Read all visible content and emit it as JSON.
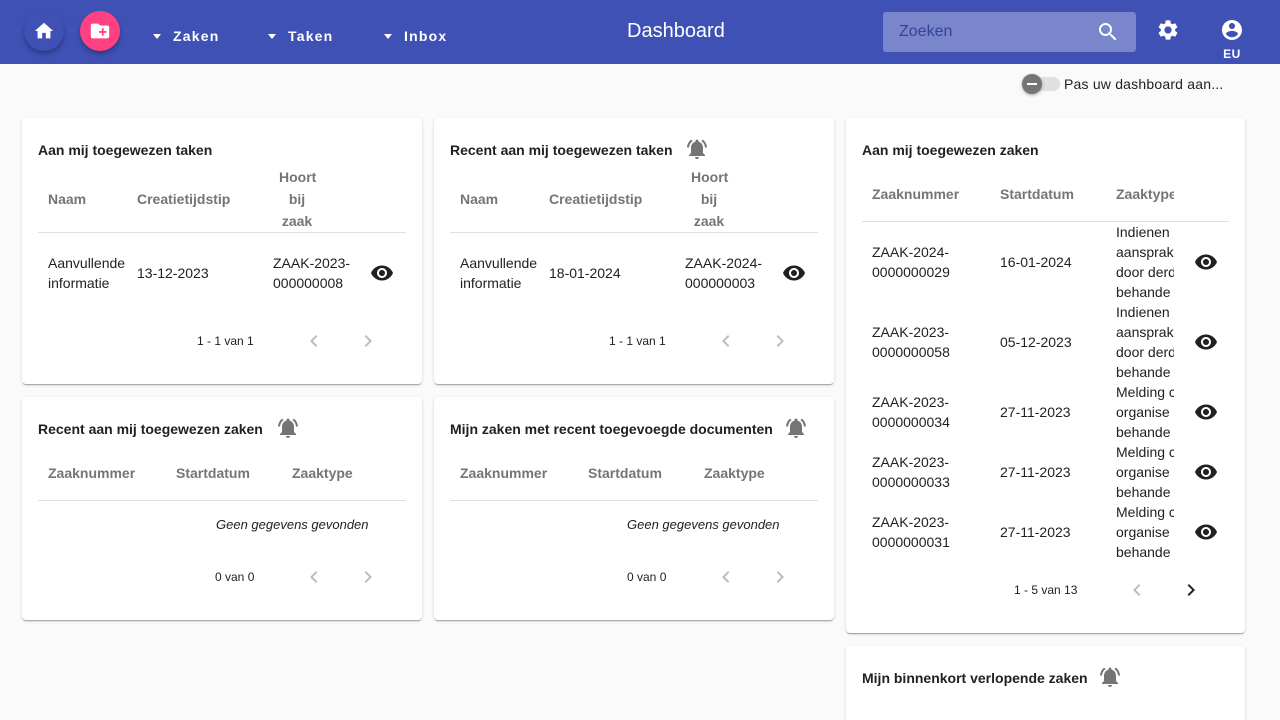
{
  "toolbar": {
    "home_icon": "home-icon",
    "new_zaak_icon": "create-new-folder-icon",
    "nav": [
      "Zaken",
      "Taken",
      "Inbox"
    ],
    "title": "Dashboard",
    "search_placeholder": "Zoeken",
    "user_label": "EU",
    "colors": {
      "primary": "#3f51b5",
      "accent": "#ff4081",
      "search_bg": "#7986cb"
    }
  },
  "toggle": {
    "label": "Pas uw dashboard aan..."
  },
  "cards": {
    "my_tasks": {
      "title": "Aan mij toegewezen taken",
      "headers": [
        "Naam",
        "Creatietijdstip",
        "Hoort",
        "bij",
        "zaak"
      ],
      "rows": [
        {
          "naam_1": "Aanvullende",
          "naam_2": "informatie",
          "created": "13-12-2023",
          "zaak_1": "ZAAK-2023-",
          "zaak_2": "000000008"
        }
      ],
      "pager": "1 - 1 van 1"
    },
    "recent_tasks": {
      "title": "Recent aan mij toegewezen taken",
      "headers": [
        "Naam",
        "Creatietijdstip",
        "Hoort",
        "bij",
        "zaak"
      ],
      "rows": [
        {
          "naam_1": "Aanvullende",
          "naam_2": "informatie",
          "created": "18-01-2024",
          "zaak_1": "ZAAK-2024-",
          "zaak_2": "000000003"
        }
      ],
      "pager": "1 - 1 van 1"
    },
    "my_zaken": {
      "title": "Aan mij toegewezen zaken",
      "headers": [
        "Zaaknummer",
        "Startdatum",
        "Zaaktype"
      ],
      "rows": [
        {
          "nr_1": "ZAAK-2024-",
          "nr_2": "0000000029",
          "date": "16-01-2024",
          "type": [
            "Indienen",
            "aansprak",
            "door derd",
            "behande"
          ]
        },
        {
          "nr_1": "ZAAK-2023-",
          "nr_2": "0000000058",
          "date": "05-12-2023",
          "type": [
            "Indienen",
            "aansprak",
            "door derd",
            "behande"
          ]
        },
        {
          "nr_1": "ZAAK-2023-",
          "nr_2": "0000000034",
          "date": "27-11-2023",
          "type": [
            "Melding c",
            "organise",
            "behande"
          ]
        },
        {
          "nr_1": "ZAAK-2023-",
          "nr_2": "0000000033",
          "date": "27-11-2023",
          "type": [
            "Melding c",
            "organise",
            "behande"
          ]
        },
        {
          "nr_1": "ZAAK-2023-",
          "nr_2": "0000000031",
          "date": "27-11-2023",
          "type": [
            "Melding c",
            "organise",
            "behande"
          ]
        }
      ],
      "pager": "1 - 5 van 13"
    },
    "recent_zaken": {
      "title": "Recent aan mij toegewezen zaken",
      "headers": [
        "Zaaknummer",
        "Startdatum",
        "Zaaktype"
      ],
      "empty": "Geen gegevens gevonden",
      "pager": "0 van 0"
    },
    "recent_docs": {
      "title": "Mijn zaken met recent toegevoegde documenten",
      "headers": [
        "Zaaknummer",
        "Startdatum",
        "Zaaktype"
      ],
      "empty": "Geen gegevens gevonden",
      "pager": "0 van 0"
    },
    "expiring": {
      "title": "Mijn binnenkort verlopende zaken"
    }
  }
}
